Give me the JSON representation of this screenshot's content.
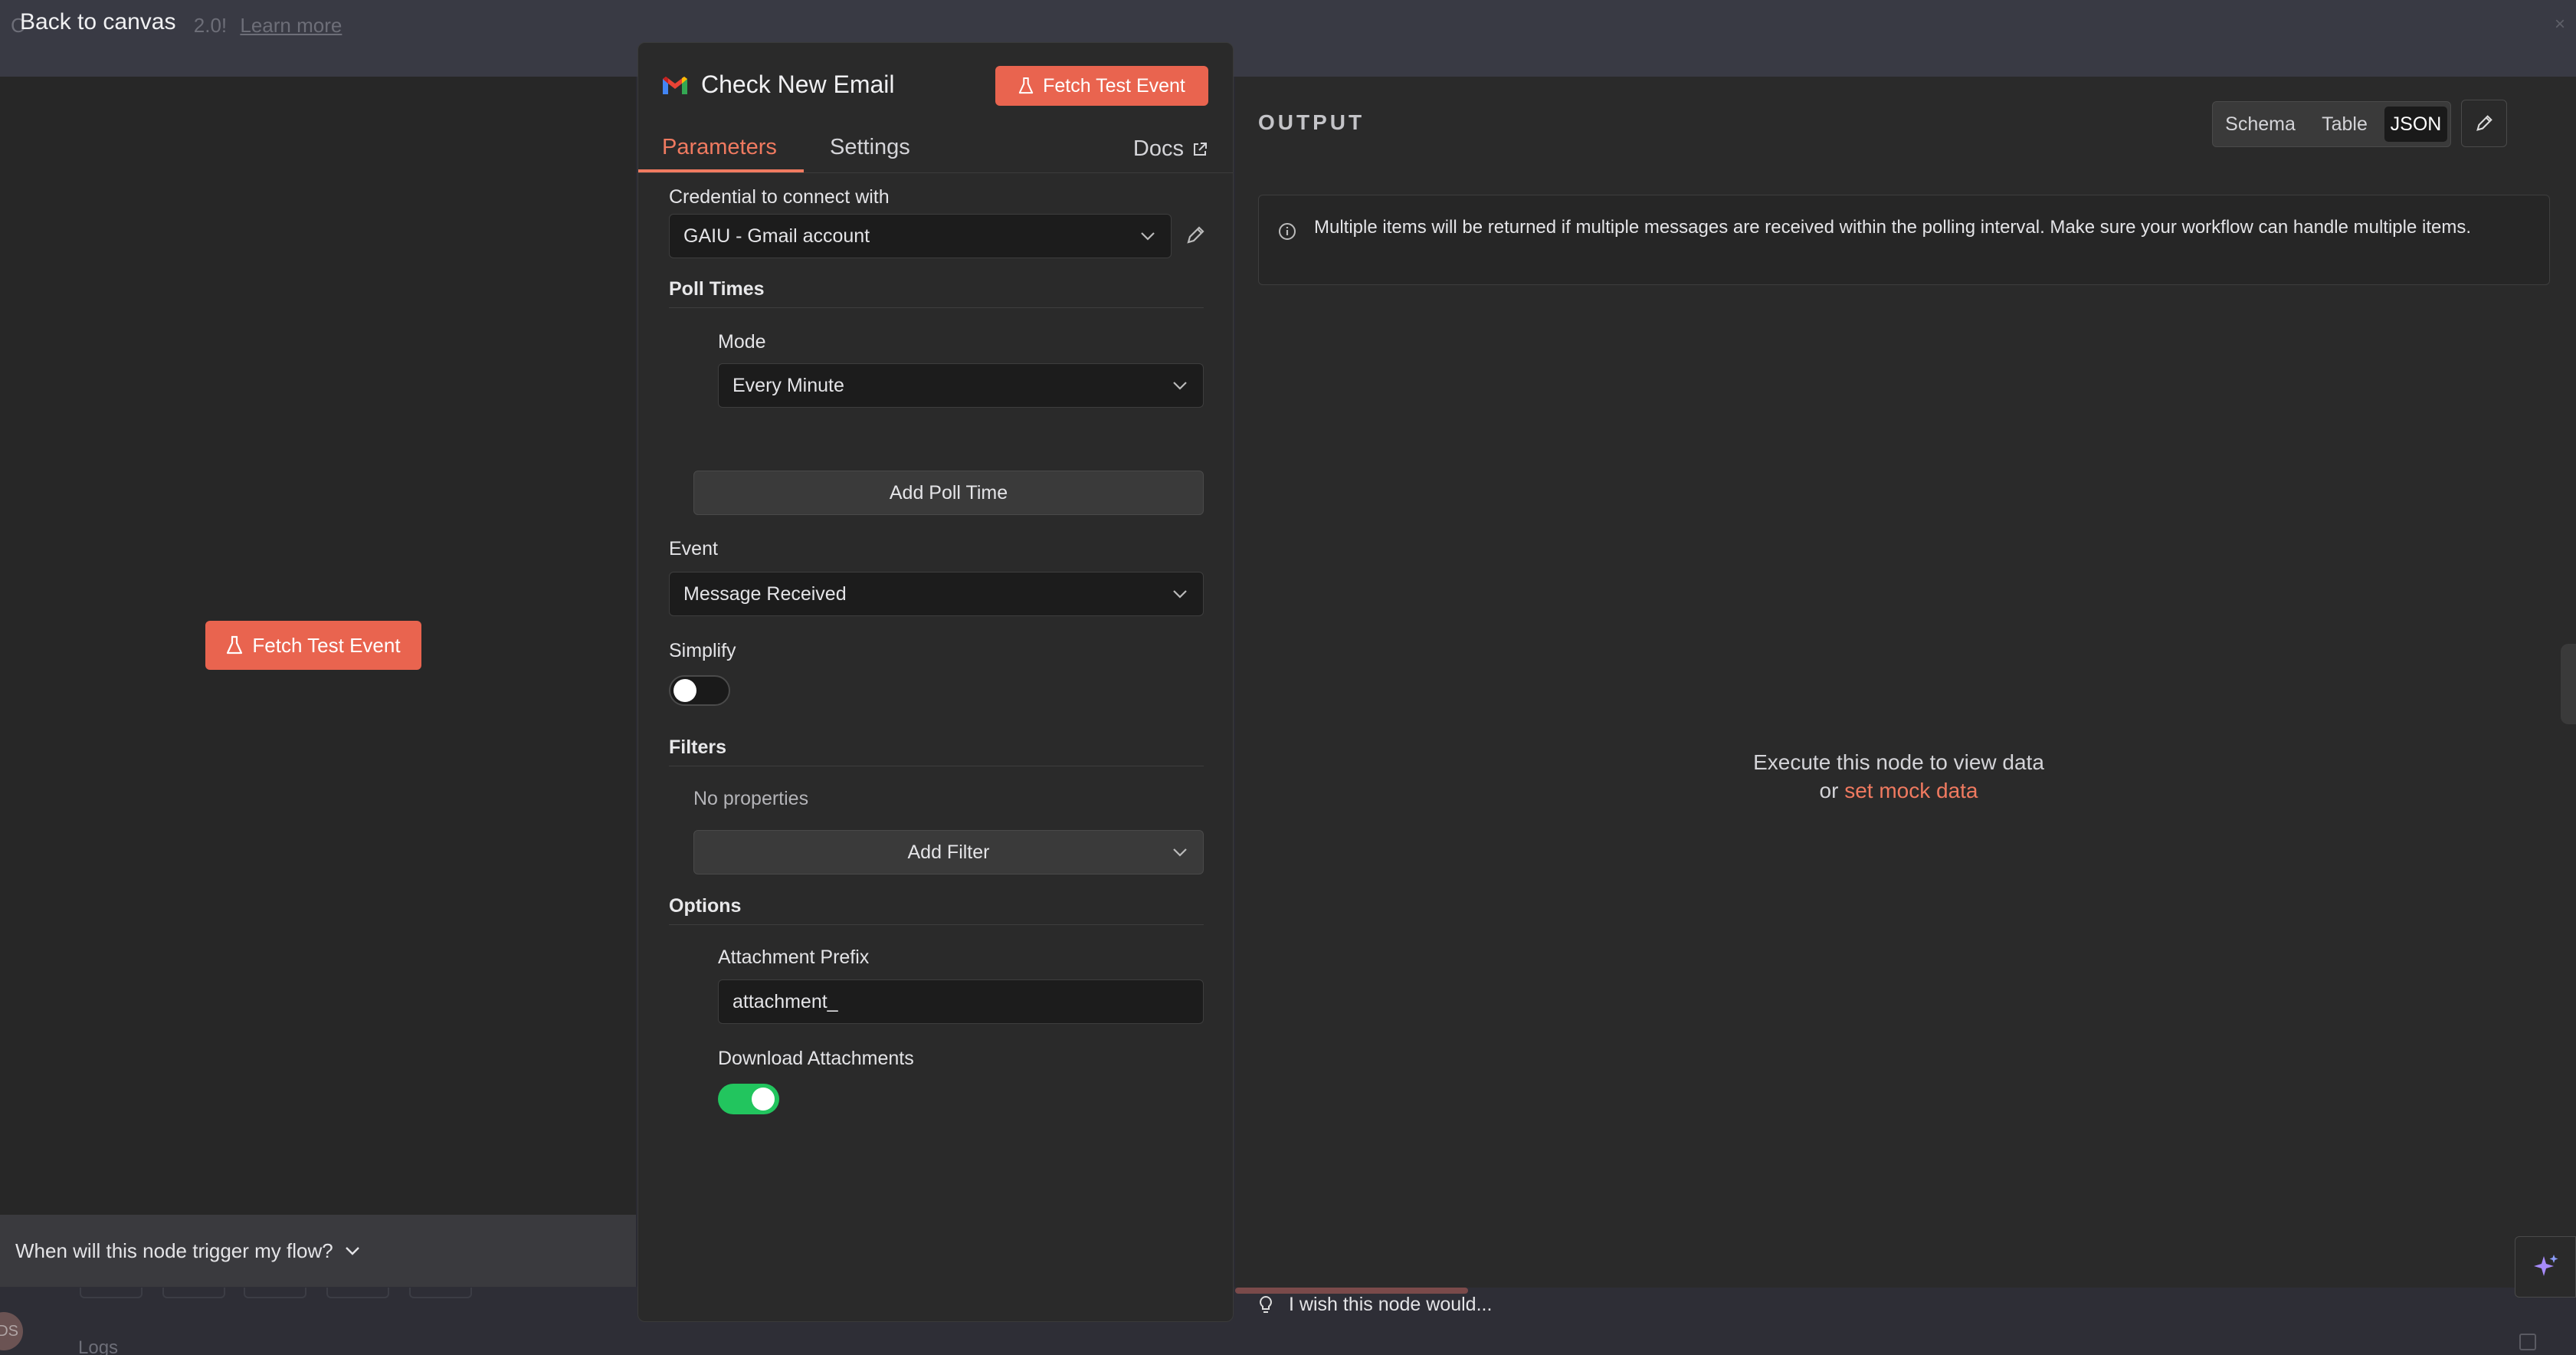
{
  "topbar": {
    "back_label": "Back to canvas",
    "ghost_prefix": "C",
    "ghost_version": "2.0!",
    "ghost_link": "Learn more",
    "close": "×"
  },
  "canvas": {
    "fetch_label": "Fetch Test Event",
    "trigger_question": "When will this node trigger my flow?",
    "logs_label": "Logs",
    "avatar_initials": "DS"
  },
  "panel": {
    "title": "Check New Email",
    "fetch_label": "Fetch Test Event",
    "tabs": [
      {
        "label": "Parameters",
        "active": true
      },
      {
        "label": "Settings",
        "active": false
      }
    ],
    "docs_label": "Docs",
    "credential": {
      "label": "Credential to connect with",
      "value": "GAIU - Gmail account"
    },
    "poll_times": {
      "label": "Poll Times",
      "mode_label": "Mode",
      "mode_value": "Every Minute",
      "add_label": "Add Poll Time"
    },
    "event": {
      "label": "Event",
      "value": "Message Received"
    },
    "simplify": {
      "label": "Simplify",
      "on": false
    },
    "filters": {
      "label": "Filters",
      "empty_text": "No properties",
      "add_label": "Add Filter"
    },
    "options": {
      "label": "Options",
      "attachment_prefix_label": "Attachment Prefix",
      "attachment_prefix_value": "attachment_",
      "download_label": "Download Attachments",
      "download_on": true
    }
  },
  "output": {
    "title": "OUTPUT",
    "views": [
      {
        "label": "Schema",
        "active": false
      },
      {
        "label": "Table",
        "active": false
      },
      {
        "label": "JSON",
        "active": true
      }
    ],
    "notice": "Multiple items will be returned if multiple messages are received within the polling interval. Make sure your workflow can handle multiple items.",
    "empty_line1": "Execute this node to view data",
    "empty_or": "or",
    "empty_link": "set mock data",
    "wish_text": "I wish this node would..."
  },
  "colors": {
    "accent": "#e9644f",
    "toggle_on": "#22c55e",
    "panel_bg": "#2a2a2a"
  }
}
